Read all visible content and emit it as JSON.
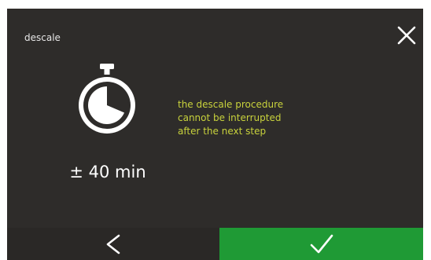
{
  "header": {
    "title": "descale",
    "close_icon": "close-icon"
  },
  "main": {
    "stopwatch_icon": "stopwatch-icon",
    "duration": "± 40 min",
    "warning_lines": [
      "the descale procedure",
      "cannot be interrupted",
      "after the next step"
    ]
  },
  "footer": {
    "back_icon": "chevron-left-icon",
    "confirm_icon": "checkmark-icon"
  },
  "colors": {
    "background": "#2e2c2a",
    "warning_text": "#c8d23c",
    "confirm_green": "#1f9a35"
  }
}
